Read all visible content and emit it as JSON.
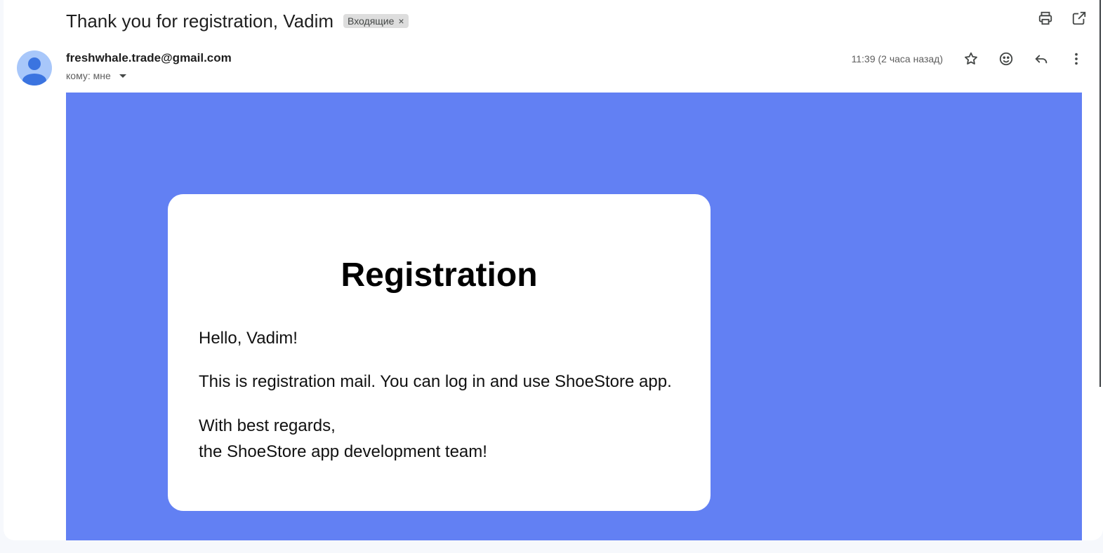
{
  "email": {
    "subject": "Thank you for registration, Vadim",
    "label": "Входящие",
    "label_close": "×",
    "sender": "freshwhale.trade@gmail.com",
    "recipient": "кому: мне",
    "time": "11:39 (2 часа назад)"
  },
  "icons": {
    "print": "print-icon",
    "open_new": "open-in-new-window-icon",
    "star": "star-icon",
    "emoji": "emoji-reaction-icon",
    "reply": "reply-icon",
    "more": "more-vertical-icon",
    "avatar": "default-avatar-icon",
    "recipient_details": "chevron-down-icon"
  },
  "body": {
    "background": "#6280f3",
    "title": "Registration",
    "greeting": "Hello, Vadim!",
    "message": "This is registration mail. You can log in and use ShoeStore app.",
    "signoff_line1": "With best regards,",
    "signoff_line2": "the ShoeStore app development team!"
  }
}
